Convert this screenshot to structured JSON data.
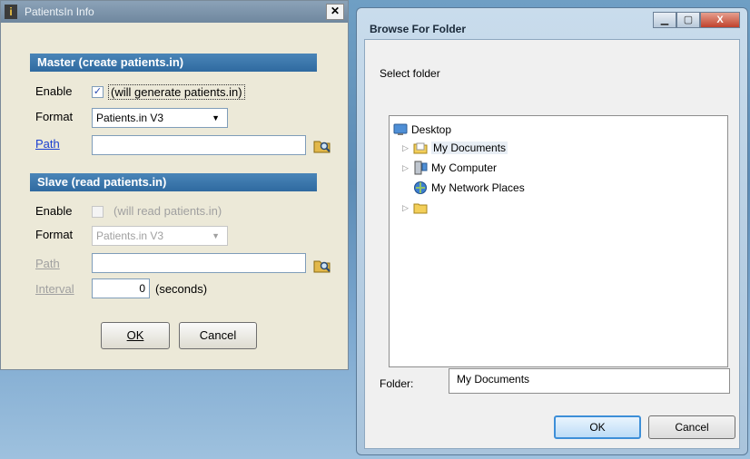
{
  "left_dialog": {
    "title": "PatientsIn Info",
    "close_label": "✕",
    "master": {
      "header": "Master   (create patients.in)",
      "enable_label": "Enable",
      "enable_checked": true,
      "enable_text": "(will generate patients.in)",
      "format_label": "Format",
      "format_value": "Patients.in V3",
      "path_label": "Path",
      "path_value": ""
    },
    "slave": {
      "header": "Slave   (read patients.in)",
      "enable_label": "Enable",
      "enable_checked": false,
      "enable_text": "(will read patients.in)",
      "format_label": "Format",
      "format_value": "Patients.in V3",
      "path_label": "Path",
      "path_value": "",
      "interval_label": "Interval",
      "interval_value": "0",
      "interval_unit": "(seconds)"
    },
    "ok_label": "OK",
    "cancel_label": "Cancel"
  },
  "right_dialog": {
    "title": "Browse For Folder",
    "close_label": "X",
    "prompt": "Select folder",
    "tree": [
      {
        "label": "Desktop",
        "icon": "desktop-icon"
      },
      {
        "label": "My Documents",
        "icon": "folder-documents-icon",
        "selected": true
      },
      {
        "label": "My Computer",
        "icon": "computer-icon"
      },
      {
        "label": "My Network Places",
        "icon": "network-icon"
      },
      {
        "label": "",
        "icon": "folder-icon"
      }
    ],
    "folder_label": "Folder:",
    "folder_value": "My Documents",
    "ok_label": "OK",
    "cancel_label": "Cancel"
  },
  "colors": {
    "group_header": "#2f6aa0",
    "link": "#1a3fd1",
    "desktop_bg": "#5b8bb5"
  }
}
